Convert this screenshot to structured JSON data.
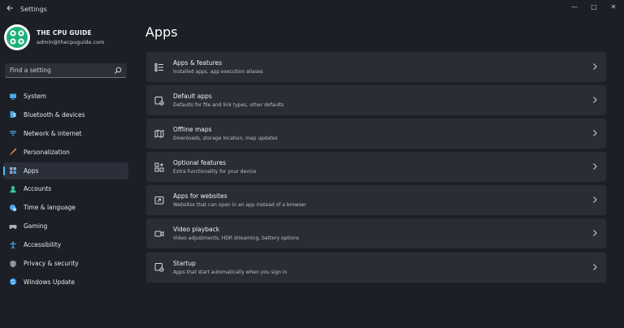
{
  "window": {
    "title": "Settings",
    "back_icon": "back-arrow-icon",
    "controls": {
      "minimize": "—",
      "maximize": "□",
      "close": "✕"
    }
  },
  "profile": {
    "name": "THE CPU GUIDE",
    "email": "admin@thecpuguide.com",
    "accent": "#1fb07a"
  },
  "search": {
    "placeholder": "Find a setting",
    "icon": "search-icon"
  },
  "sidebar": {
    "items": [
      {
        "label": "System",
        "icon": "system-icon",
        "active": false
      },
      {
        "label": "Bluetooth & devices",
        "icon": "bluetooth-icon",
        "active": false
      },
      {
        "label": "Network & internet",
        "icon": "wifi-icon",
        "active": false
      },
      {
        "label": "Personalization",
        "icon": "brush-icon",
        "active": false
      },
      {
        "label": "Apps",
        "icon": "apps-icon",
        "active": true
      },
      {
        "label": "Accounts",
        "icon": "account-icon",
        "active": false
      },
      {
        "label": "Time & language",
        "icon": "globe-clock-icon",
        "active": false
      },
      {
        "label": "Gaming",
        "icon": "gamepad-icon",
        "active": false
      },
      {
        "label": "Accessibility",
        "icon": "accessibility-icon",
        "active": false
      },
      {
        "label": "Privacy & security",
        "icon": "shield-icon",
        "active": false
      },
      {
        "label": "Windows Update",
        "icon": "update-icon",
        "active": false
      }
    ]
  },
  "main": {
    "title": "Apps",
    "cards": [
      {
        "title": "Apps & features",
        "subtitle": "Installed apps, app execution aliases",
        "icon": "list-icon"
      },
      {
        "title": "Default apps",
        "subtitle": "Defaults for file and link types, other defaults",
        "icon": "default-apps-icon"
      },
      {
        "title": "Offline maps",
        "subtitle": "Downloads, storage location, map updates",
        "icon": "map-icon"
      },
      {
        "title": "Optional features",
        "subtitle": "Extra functionality for your device",
        "icon": "add-features-icon"
      },
      {
        "title": "Apps for websites",
        "subtitle": "Websites that can open in an app instead of a browser",
        "icon": "web-app-icon"
      },
      {
        "title": "Video playback",
        "subtitle": "Video adjustments, HDR streaming, battery options",
        "icon": "video-icon"
      },
      {
        "title": "Startup",
        "subtitle": "Apps that start automatically when you sign in",
        "icon": "startup-icon"
      }
    ]
  },
  "colors": {
    "background": "#1c1f26",
    "card": "#2a2d36",
    "accent": "#4cc2ff"
  }
}
